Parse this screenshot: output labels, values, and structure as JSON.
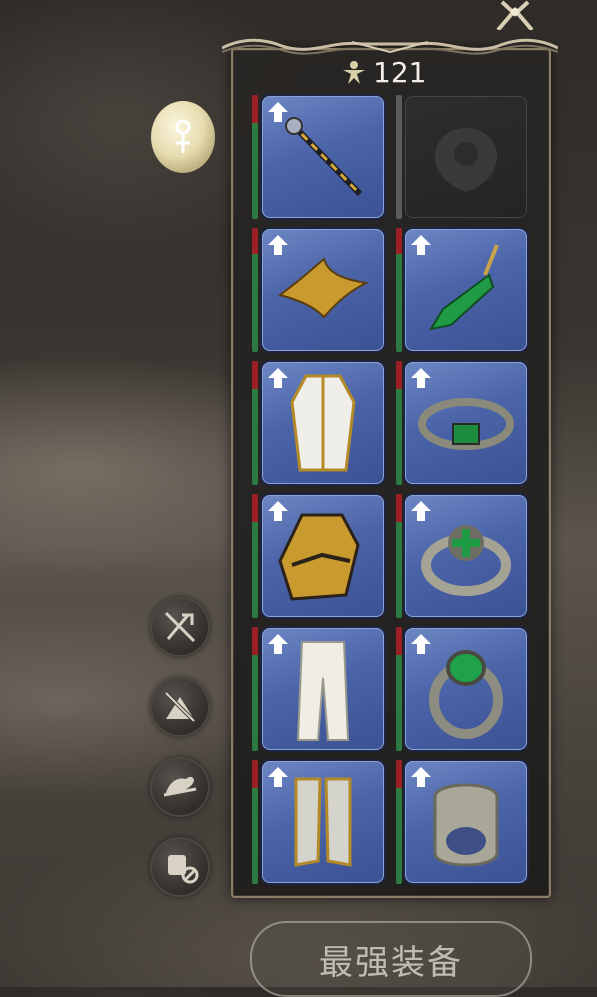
{
  "currency": {
    "value": "121",
    "icon": "star-figure-icon"
  },
  "equipment": {
    "slots": [
      {
        "id": "weapon",
        "item": "golden-staff-icon",
        "upgrade": true,
        "filled": true
      },
      {
        "id": "offhand",
        "item": "empty-crest-icon",
        "upgrade": false,
        "filled": false
      },
      {
        "id": "head",
        "item": "golden-circlet-icon",
        "upgrade": true,
        "filled": true
      },
      {
        "id": "earring",
        "item": "green-gem-earring-icon",
        "upgrade": true,
        "filled": true
      },
      {
        "id": "body",
        "item": "white-gold-robe-icon",
        "upgrade": true,
        "filled": true
      },
      {
        "id": "necklace",
        "item": "emerald-band-icon",
        "upgrade": true,
        "filled": true
      },
      {
        "id": "hands",
        "item": "golden-gauntlet-icon",
        "upgrade": true,
        "filled": true
      },
      {
        "id": "bracelet",
        "item": "emerald-cross-ring-icon",
        "upgrade": true,
        "filled": true
      },
      {
        "id": "legs",
        "item": "white-trousers-icon",
        "upgrade": true,
        "filled": true
      },
      {
        "id": "ring1",
        "item": "emerald-ring-icon",
        "upgrade": true,
        "filled": true
      },
      {
        "id": "feet",
        "item": "armored-boots-icon",
        "upgrade": true,
        "filled": true
      },
      {
        "id": "ring2",
        "item": "silver-band-ring-icon",
        "upgrade": true,
        "filled": true
      }
    ]
  },
  "side_buttons": [
    "hide-weapon-icon",
    "hide-headgear-icon",
    "hat-toggle-icon",
    "hide-face-icon"
  ],
  "best_gear_button": {
    "label": "最强装备"
  },
  "colors": {
    "slot_blue": "#4b64a8",
    "bar_green": "#2c7a41",
    "bar_red": "#9b1f24",
    "panel_border": "#8c7e66"
  }
}
